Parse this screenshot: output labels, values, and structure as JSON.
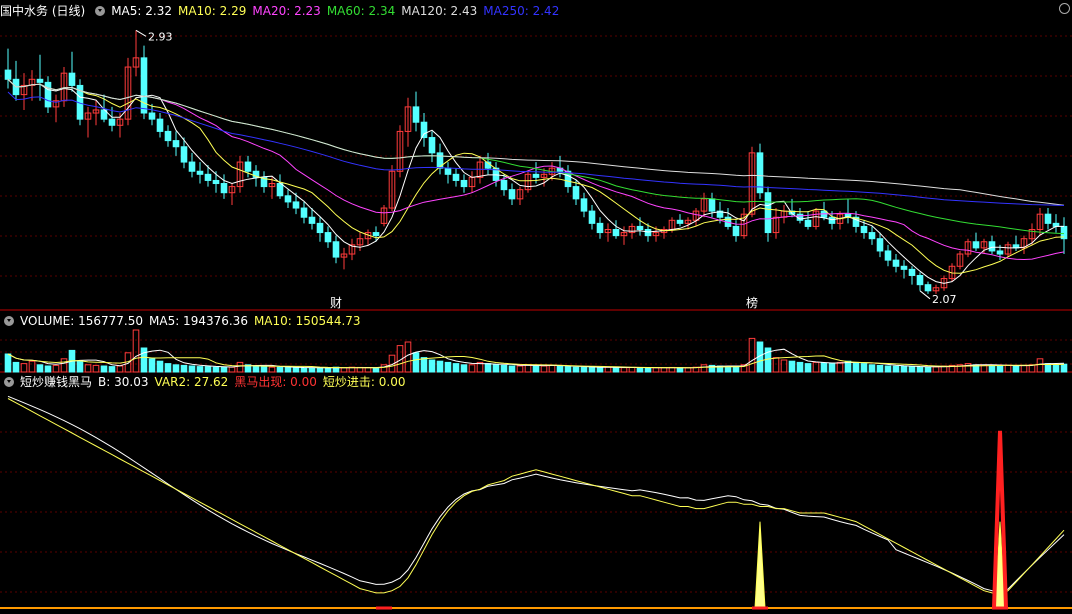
{
  "colors": {
    "bg": "#000000",
    "up": "#ff3b3b",
    "down": "#54ffff",
    "grid": "#5a0000",
    "sep": "#c00000",
    "ma5": "#ffffff",
    "ma10": "#ffff55",
    "ma20": "#ff44ff",
    "ma60": "#33dd33",
    "ma120": "#dddddd",
    "ma250": "#3333ff",
    "label": "#ffffff"
  },
  "price_panel": {
    "title": "国中水务 (日线)",
    "ma": [
      {
        "label": "MA5: 2.32",
        "color": "#ffffff"
      },
      {
        "label": "MA10: 2.29",
        "color": "#ffff55"
      },
      {
        "label": "MA20: 2.23",
        "color": "#ff44ff"
      },
      {
        "label": "MA60: 2.34",
        "color": "#33dd33"
      },
      {
        "label": "MA120: 2.43",
        "color": "#dddddd"
      },
      {
        "label": "MA250: 2.42",
        "color": "#3333ff"
      }
    ],
    "high_label": "2.93",
    "low_label": "2.07",
    "markers": [
      "财",
      "榜"
    ]
  },
  "volume_panel": {
    "title": "VOLUME: 156777.50",
    "ma": [
      {
        "label": "MA5: 194376.36",
        "color": "#ffffff"
      },
      {
        "label": "MA10: 150544.73",
        "color": "#ffff55"
      }
    ]
  },
  "indicator_panel": {
    "title": "短炒赚钱黑马",
    "items": [
      {
        "label": "B: 30.03",
        "color": "#ffffff"
      },
      {
        "label": "VAR2: 27.62",
        "color": "#ffff55"
      },
      {
        "label": "黑马出现: 0.00",
        "color": "#ff3333"
      },
      {
        "label": "短炒进击: 0.00",
        "color": "#ffff55"
      }
    ]
  },
  "chart_data": {
    "type": "candlestick",
    "ohlc": [
      [
        2.8,
        2.87,
        2.74,
        2.77
      ],
      [
        2.77,
        2.83,
        2.7,
        2.72
      ],
      [
        2.72,
        2.79,
        2.67,
        2.75
      ],
      [
        2.75,
        2.8,
        2.7,
        2.77
      ],
      [
        2.77,
        2.85,
        2.7,
        2.76
      ],
      [
        2.76,
        2.78,
        2.66,
        2.68
      ],
      [
        2.68,
        2.72,
        2.63,
        2.7
      ],
      [
        2.7,
        2.81,
        2.68,
        2.79
      ],
      [
        2.79,
        2.86,
        2.73,
        2.75
      ],
      [
        2.75,
        2.77,
        2.62,
        2.64
      ],
      [
        2.64,
        2.68,
        2.58,
        2.66
      ],
      [
        2.66,
        2.7,
        2.62,
        2.67
      ],
      [
        2.67,
        2.72,
        2.63,
        2.64
      ],
      [
        2.64,
        2.68,
        2.6,
        2.62
      ],
      [
        2.62,
        2.66,
        2.58,
        2.64
      ],
      [
        2.64,
        2.84,
        2.62,
        2.81
      ],
      [
        2.81,
        2.93,
        2.78,
        2.84
      ],
      [
        2.84,
        2.88,
        2.64,
        2.66
      ],
      [
        2.66,
        2.69,
        2.62,
        2.64
      ],
      [
        2.64,
        2.66,
        2.58,
        2.6
      ],
      [
        2.6,
        2.62,
        2.55,
        2.57
      ],
      [
        2.57,
        2.6,
        2.52,
        2.55
      ],
      [
        2.55,
        2.58,
        2.48,
        2.5
      ],
      [
        2.5,
        2.53,
        2.45,
        2.47
      ],
      [
        2.47,
        2.5,
        2.43,
        2.46
      ],
      [
        2.46,
        2.49,
        2.42,
        2.44
      ],
      [
        2.44,
        2.47,
        2.4,
        2.43
      ],
      [
        2.43,
        2.46,
        2.38,
        2.4
      ],
      [
        2.4,
        2.43,
        2.36,
        2.42
      ],
      [
        2.42,
        2.52,
        2.4,
        2.5
      ],
      [
        2.5,
        2.52,
        2.45,
        2.47
      ],
      [
        2.47,
        2.49,
        2.42,
        2.45
      ],
      [
        2.45,
        2.47,
        2.4,
        2.42
      ],
      [
        2.42,
        2.45,
        2.38,
        2.43
      ],
      [
        2.43,
        2.46,
        2.38,
        2.39
      ],
      [
        2.39,
        2.41,
        2.35,
        2.37
      ],
      [
        2.37,
        2.4,
        2.33,
        2.35
      ],
      [
        2.35,
        2.37,
        2.3,
        2.32
      ],
      [
        2.32,
        2.35,
        2.28,
        2.3
      ],
      [
        2.3,
        2.32,
        2.24,
        2.27
      ],
      [
        2.27,
        2.29,
        2.22,
        2.24
      ],
      [
        2.24,
        2.26,
        2.17,
        2.19
      ],
      [
        2.19,
        2.22,
        2.15,
        2.2
      ],
      [
        2.2,
        2.25,
        2.18,
        2.23
      ],
      [
        2.23,
        2.27,
        2.21,
        2.25
      ],
      [
        2.25,
        2.28,
        2.23,
        2.27
      ],
      [
        2.27,
        2.29,
        2.24,
        2.26
      ],
      [
        2.3,
        2.36,
        2.29,
        2.35
      ],
      [
        2.35,
        2.49,
        2.34,
        2.47
      ],
      [
        2.47,
        2.62,
        2.45,
        2.6
      ],
      [
        2.6,
        2.71,
        2.55,
        2.68
      ],
      [
        2.68,
        2.73,
        2.6,
        2.63
      ],
      [
        2.63,
        2.66,
        2.55,
        2.58
      ],
      [
        2.58,
        2.6,
        2.5,
        2.53
      ],
      [
        2.53,
        2.56,
        2.46,
        2.48
      ],
      [
        2.48,
        2.5,
        2.43,
        2.46
      ],
      [
        2.46,
        2.48,
        2.42,
        2.44
      ],
      [
        2.44,
        2.46,
        2.4,
        2.42
      ],
      [
        2.42,
        2.47,
        2.4,
        2.45
      ],
      [
        2.45,
        2.52,
        2.43,
        2.5
      ],
      [
        2.5,
        2.53,
        2.46,
        2.48
      ],
      [
        2.48,
        2.5,
        2.42,
        2.44
      ],
      [
        2.44,
        2.46,
        2.39,
        2.41
      ],
      [
        2.41,
        2.43,
        2.36,
        2.38
      ],
      [
        2.38,
        2.42,
        2.36,
        2.41
      ],
      [
        2.41,
        2.47,
        2.4,
        2.46
      ],
      [
        2.46,
        2.5,
        2.43,
        2.45
      ],
      [
        2.45,
        2.48,
        2.42,
        2.46
      ],
      [
        2.46,
        2.5,
        2.44,
        2.48
      ],
      [
        2.48,
        2.52,
        2.45,
        2.47
      ],
      [
        2.47,
        2.49,
        2.4,
        2.42
      ],
      [
        2.42,
        2.44,
        2.36,
        2.38
      ],
      [
        2.38,
        2.4,
        2.32,
        2.34
      ],
      [
        2.34,
        2.36,
        2.28,
        2.3
      ],
      [
        2.3,
        2.32,
        2.25,
        2.27
      ],
      [
        2.27,
        2.3,
        2.24,
        2.28
      ],
      [
        2.28,
        2.31,
        2.25,
        2.26
      ],
      [
        2.26,
        2.29,
        2.23,
        2.27
      ],
      [
        2.27,
        2.3,
        2.25,
        2.29
      ],
      [
        2.29,
        2.32,
        2.26,
        2.28
      ],
      [
        2.28,
        2.3,
        2.24,
        2.26
      ],
      [
        2.26,
        2.29,
        2.24,
        2.27
      ],
      [
        2.27,
        2.29,
        2.25,
        2.28
      ],
      [
        2.28,
        2.32,
        2.27,
        2.31
      ],
      [
        2.31,
        2.33,
        2.29,
        2.3
      ],
      [
        2.3,
        2.32,
        2.28,
        2.31
      ],
      [
        2.31,
        2.35,
        2.29,
        2.34
      ],
      [
        2.34,
        2.4,
        2.32,
        2.38
      ],
      [
        2.38,
        2.4,
        2.32,
        2.34
      ],
      [
        2.34,
        2.37,
        2.3,
        2.32
      ],
      [
        2.32,
        2.35,
        2.28,
        2.29
      ],
      [
        2.29,
        2.31,
        2.24,
        2.26
      ],
      [
        2.26,
        2.35,
        2.25,
        2.33
      ],
      [
        2.33,
        2.55,
        2.32,
        2.53
      ],
      [
        2.53,
        2.56,
        2.38,
        2.4
      ],
      [
        2.4,
        2.42,
        2.24,
        2.27
      ],
      [
        2.27,
        2.35,
        2.25,
        2.32
      ],
      [
        2.32,
        2.36,
        2.3,
        2.34
      ],
      [
        2.34,
        2.38,
        2.32,
        2.33
      ],
      [
        2.33,
        2.35,
        2.3,
        2.31
      ],
      [
        2.31,
        2.34,
        2.28,
        2.29
      ],
      [
        2.29,
        2.35,
        2.28,
        2.34
      ],
      [
        2.34,
        2.37,
        2.31,
        2.32
      ],
      [
        2.32,
        2.34,
        2.28,
        2.3
      ],
      [
        2.3,
        2.34,
        2.28,
        2.33
      ],
      [
        2.33,
        2.38,
        2.3,
        2.32
      ],
      [
        2.32,
        2.34,
        2.27,
        2.29
      ],
      [
        2.29,
        2.31,
        2.25,
        2.27
      ],
      [
        2.27,
        2.29,
        2.23,
        2.25
      ],
      [
        2.25,
        2.27,
        2.19,
        2.21
      ],
      [
        2.21,
        2.23,
        2.16,
        2.18
      ],
      [
        2.18,
        2.2,
        2.14,
        2.16
      ],
      [
        2.16,
        2.18,
        2.12,
        2.15
      ],
      [
        2.15,
        2.16,
        2.1,
        2.13
      ],
      [
        2.13,
        2.14,
        2.08,
        2.1
      ],
      [
        2.1,
        2.11,
        2.07,
        2.08
      ],
      [
        2.08,
        2.1,
        2.07,
        2.09
      ],
      [
        2.09,
        2.13,
        2.08,
        2.12
      ],
      [
        2.12,
        2.17,
        2.11,
        2.16
      ],
      [
        2.16,
        2.21,
        2.15,
        2.2
      ],
      [
        2.2,
        2.25,
        2.19,
        2.24
      ],
      [
        2.24,
        2.27,
        2.21,
        2.22
      ],
      [
        2.22,
        2.25,
        2.2,
        2.24
      ],
      [
        2.24,
        2.26,
        2.2,
        2.21
      ],
      [
        2.21,
        2.23,
        2.18,
        2.2
      ],
      [
        2.2,
        2.24,
        2.19,
        2.23
      ],
      [
        2.23,
        2.26,
        2.21,
        2.22
      ],
      [
        2.22,
        2.26,
        2.2,
        2.25
      ],
      [
        2.25,
        2.3,
        2.23,
        2.28
      ],
      [
        2.28,
        2.35,
        2.26,
        2.33
      ],
      [
        2.33,
        2.35,
        2.28,
        2.3
      ],
      [
        2.3,
        2.33,
        2.27,
        2.29
      ],
      [
        2.29,
        2.32,
        2.2,
        2.25
      ]
    ],
    "volume": [
      150,
      80,
      70,
      90,
      60,
      50,
      55,
      110,
      180,
      90,
      60,
      55,
      50,
      45,
      50,
      160,
      350,
      200,
      110,
      90,
      70,
      60,
      55,
      50,
      45,
      45,
      40,
      40,
      40,
      80,
      60,
      50,
      45,
      40,
      40,
      38,
      36,
      35,
      34,
      33,
      32,
      40,
      35,
      40,
      38,
      36,
      35,
      60,
      140,
      220,
      250,
      160,
      120,
      100,
      90,
      80,
      70,
      60,
      60,
      80,
      70,
      60,
      55,
      50,
      50,
      60,
      55,
      50,
      55,
      50,
      45,
      40,
      40,
      38,
      36,
      40,
      38,
      36,
      38,
      36,
      34,
      35,
      36,
      38,
      36,
      35,
      40,
      60,
      55,
      50,
      45,
      40,
      60,
      280,
      250,
      200,
      120,
      100,
      90,
      80,
      70,
      80,
      75,
      70,
      80,
      90,
      80,
      70,
      60,
      55,
      50,
      48,
      46,
      45,
      42,
      40,
      42,
      50,
      55,
      60,
      70,
      60,
      58,
      55,
      50,
      55,
      50,
      55,
      60,
      110,
      70,
      60,
      65
    ],
    "var2": [
      97,
      95,
      93,
      91,
      89,
      87,
      85,
      83,
      81,
      79,
      77,
      75,
      73,
      71,
      69,
      67,
      65,
      63,
      61,
      59,
      57,
      55,
      53,
      51,
      49,
      47,
      45,
      43,
      41,
      39,
      37,
      35,
      33,
      31,
      29,
      27,
      25,
      23,
      21,
      19,
      17,
      15,
      13,
      11,
      9,
      8,
      7,
      7,
      8,
      10,
      14,
      20,
      27,
      34,
      40,
      45,
      49,
      52,
      54,
      55,
      57,
      58,
      59,
      61,
      62,
      63,
      64,
      63,
      62,
      61,
      60,
      59,
      58,
      57,
      56,
      55,
      54,
      53,
      52,
      52,
      51,
      50,
      49,
      48,
      47,
      47,
      46,
      46,
      47,
      48,
      49,
      49,
      48,
      48,
      47,
      47,
      46,
      46,
      45,
      44,
      44,
      44,
      44,
      43,
      42,
      41,
      40,
      38,
      36,
      34,
      32,
      30,
      28,
      26,
      24,
      22,
      20,
      18,
      16,
      14,
      12,
      10,
      8,
      7,
      6,
      8,
      12,
      16,
      20,
      24,
      28,
      32,
      36,
      40,
      44,
      48,
      52,
      55,
      58,
      60,
      62,
      63
    ],
    "b": [],
    "heima_signal": [
      124
    ],
    "duanchao_signal": [
      94,
      124
    ],
    "price_range": [
      2.05,
      2.97
    ],
    "volume_max": 350,
    "indicator_range": [
      0,
      100
    ],
    "high_index": 16,
    "low_index": 114
  }
}
